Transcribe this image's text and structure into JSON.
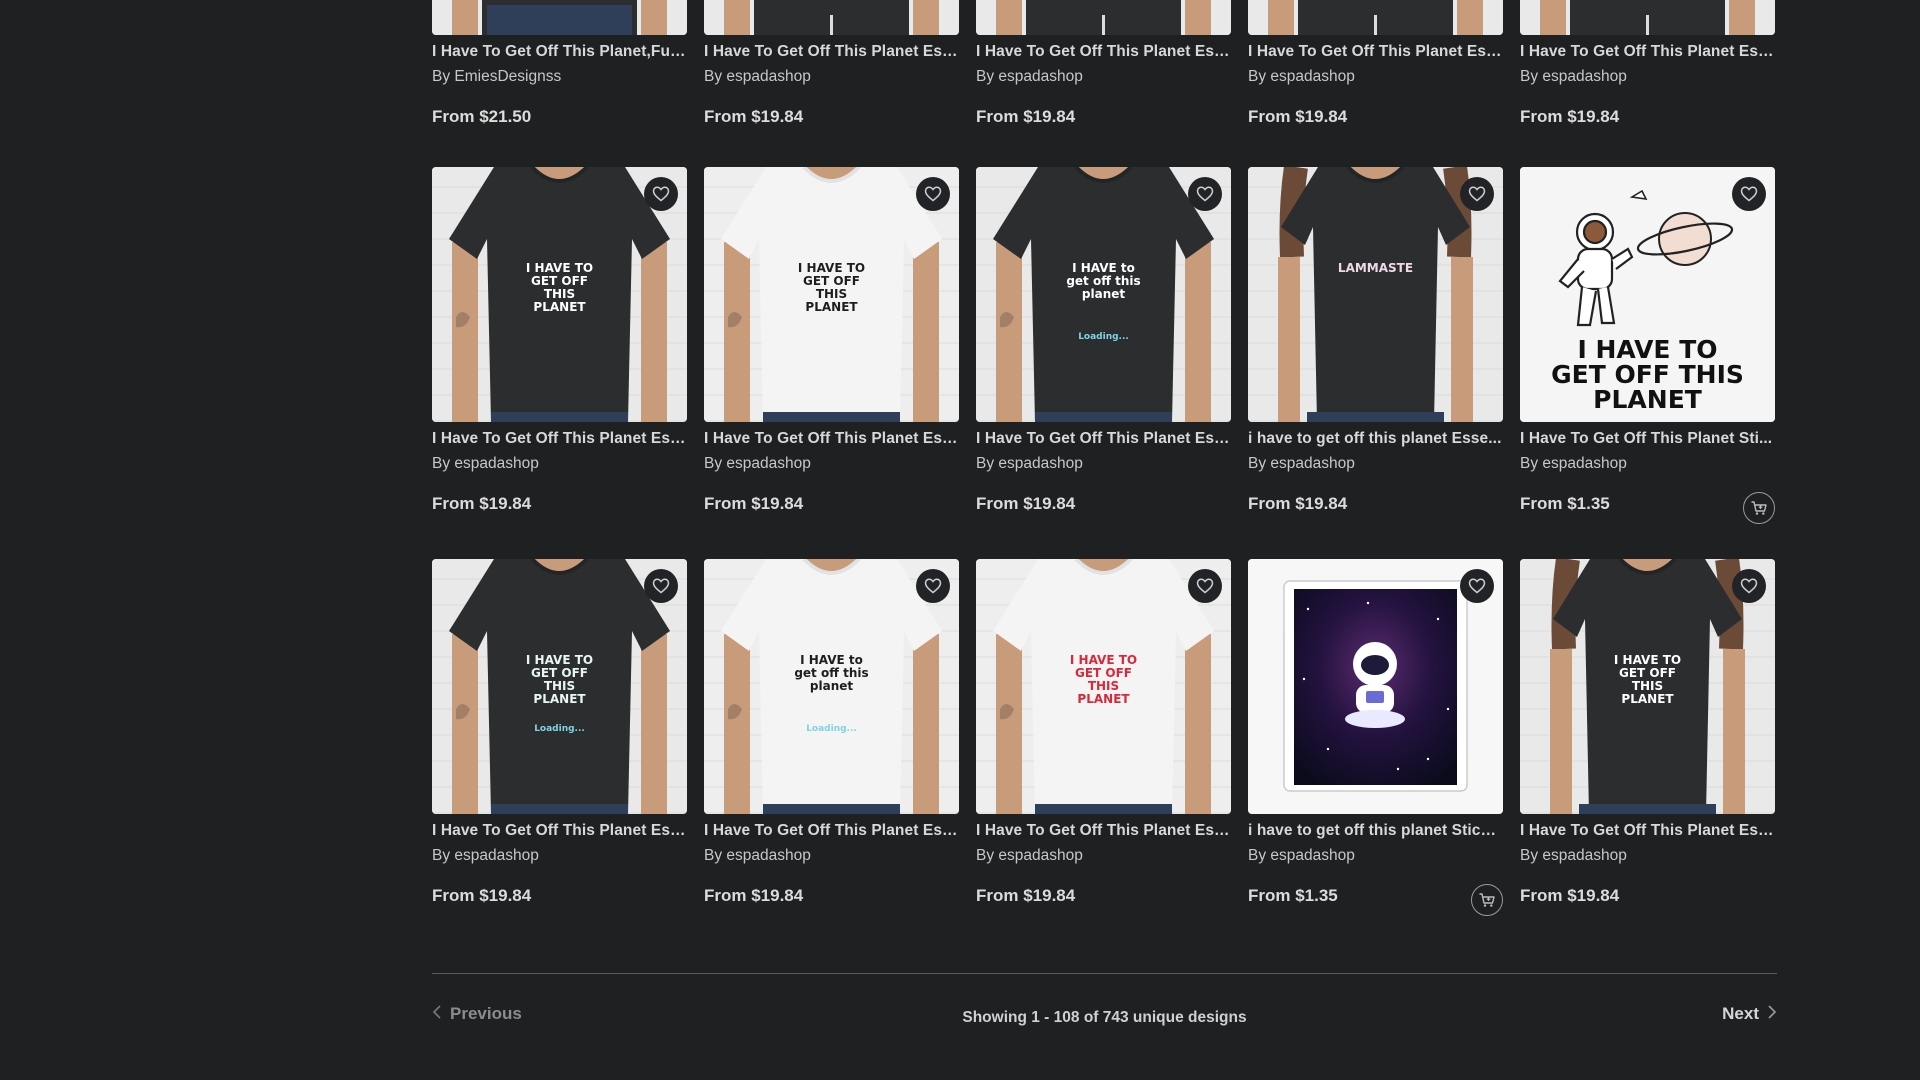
{
  "colors": {
    "page_bg": "#1f2022",
    "text": "#d8d8d8",
    "muted": "#8c8c8c",
    "shirt_dark": "#2c2d2f",
    "shirt_white": "#f4f4f4"
  },
  "rows": [
    {
      "cards": [
        {
          "title": "I Have To Get Off This Planet,Fun...",
          "by": "By EmiesDesignss",
          "price": "From $21.50",
          "shirt": "dark",
          "type": "shirt-partial"
        },
        {
          "title": "I Have To Get Off This Planet Ess...",
          "by": "By espadashop",
          "price": "From $19.84",
          "shirt": "dark",
          "type": "shirt-partial"
        },
        {
          "title": "I Have To Get Off This Planet Ess...",
          "by": "By espadashop",
          "price": "From $19.84",
          "shirt": "dark",
          "type": "shirt-partial"
        },
        {
          "title": "I Have To Get Off This Planet Ess...",
          "by": "By espadashop",
          "price": "From $19.84",
          "shirt": "dark",
          "type": "shirt-partial"
        },
        {
          "title": "I Have To Get Off This Planet Ess...",
          "by": "By espadashop",
          "price": "From $19.84",
          "shirt": "dark",
          "type": "shirt-partial"
        }
      ]
    },
    {
      "cards": [
        {
          "title": "I Have To Get Off This Planet Ess...",
          "by": "By espadashop",
          "price": "From $19.84",
          "shirt": "dark",
          "type": "shirt",
          "design": "I HAVE TO GET OFF THIS PLANET",
          "design_color": "#ffffff"
        },
        {
          "title": "I Have To Get Off This Planet Ess...",
          "by": "By espadashop",
          "price": "From $19.84",
          "shirt": "white",
          "type": "shirt",
          "design": "I HAVE TO GET OFF THIS PLANET",
          "design_color": "#1e1e1e"
        },
        {
          "title": "I Have To Get Off This Planet Ess...",
          "by": "By espadashop",
          "price": "From $19.84",
          "shirt": "dark",
          "type": "shirt",
          "design": "I HAVE to get off this planet",
          "design_color": "#ffffff",
          "design_sub": "Loading..."
        },
        {
          "title": "i have to get off this planet Esse...",
          "by": "By espadashop",
          "price": "From $19.84",
          "shirt": "dark",
          "type": "shirt-woman",
          "design": "LAMMASTE",
          "design_color": "#f0d9e6"
        },
        {
          "title": "I Have To Get Off This Planet Sti...",
          "by": "By espadashop",
          "price": "From $1.35",
          "type": "sticker-astronaut",
          "design": "I HAVE TO GET OFF THIS PLANET",
          "cart": true
        }
      ]
    },
    {
      "cards": [
        {
          "title": "I Have To Get Off This Planet Ess...",
          "by": "By espadashop",
          "price": "From $19.84",
          "shirt": "dark",
          "type": "shirt",
          "design": "I HAVE TO GET OFF THIS PLANET",
          "design_color": "#e6f7f2",
          "design_sub": "Loading..."
        },
        {
          "title": "I Have To Get Off This Planet Ess...",
          "by": "By espadashop",
          "price": "From $19.84",
          "shirt": "white",
          "type": "shirt",
          "design": "I HAVE to get off this planet",
          "design_color": "#1e1e1e",
          "design_sub": "Loading..."
        },
        {
          "title": "I Have To Get Off This Planet Ess...",
          "by": "By espadashop",
          "price": "From $19.84",
          "shirt": "white",
          "type": "shirt",
          "design": "I HAVE TO GET OFF THIS PLANET",
          "design_color": "#d9283a"
        },
        {
          "title": "i have to get off this planet Sticker",
          "by": "By espadashop",
          "price": "From $1.35",
          "type": "sticker-poster",
          "cart": true
        },
        {
          "title": "I Have To Get Off This Planet Ess...",
          "by": "By espadashop",
          "price": "From $19.84",
          "shirt": "dark",
          "type": "shirt-woman",
          "design": "I HAVE TO GET OFF THIS PLANET",
          "design_color": "#ffffff"
        }
      ]
    }
  ],
  "pagination": {
    "prev_label": "Previous",
    "next_label": "Next",
    "showing": "Showing 1 - 108 of 743 unique designs"
  }
}
